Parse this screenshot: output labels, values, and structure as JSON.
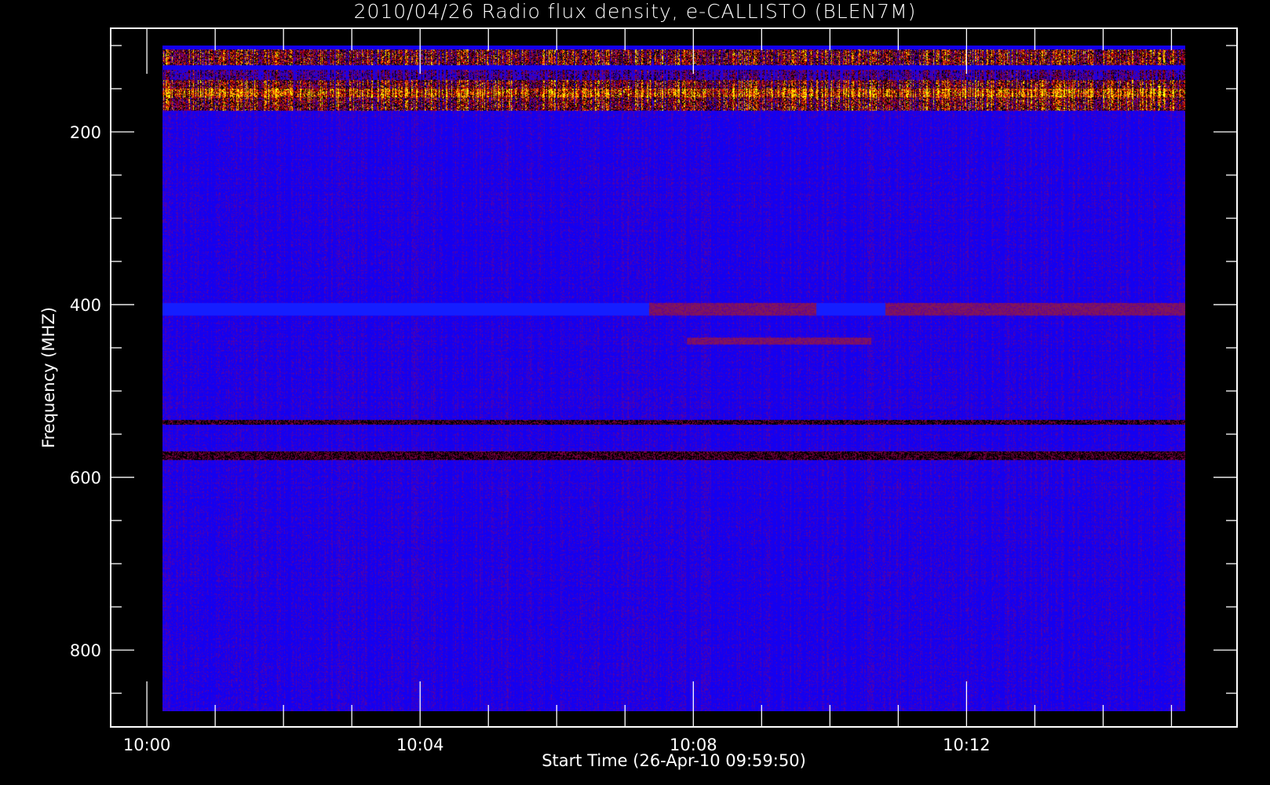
{
  "chart_data": {
    "type": "heatmap",
    "title": "2010/04/26  Radio flux density, e-CALLISTO (BLEN7M)",
    "xlabel": "Start Time (26-Apr-10 09:59:50)",
    "ylabel": "Frequency (MHZ)",
    "x_ticks": [
      {
        "label": "10:00",
        "min": 0
      },
      {
        "label": "10:04",
        "min": 4
      },
      {
        "label": "10:08",
        "min": 8
      },
      {
        "label": "10:12",
        "min": 12
      }
    ],
    "x_minor_step_min": 1,
    "y_ticks": [
      {
        "label": "200",
        "mhz": 200
      },
      {
        "label": "400",
        "mhz": 400
      },
      {
        "label": "600",
        "mhz": 600
      },
      {
        "label": "800",
        "mhz": 800
      }
    ],
    "y_minor_step_mhz": 50,
    "xlim_min_after_1000": [
      -0.53,
      15.96
    ],
    "ylim_mhz": [
      889,
      80
    ],
    "data_extent": {
      "time_start_min": 0.23,
      "time_end_min": 15.2,
      "freq_min_mhz": 100,
      "freq_max_mhz": 871
    },
    "colormap": [
      "#1400f0",
      "#5a00a0",
      "#78003c",
      "#000000",
      "#c80000",
      "#ff7800",
      "#ffff00"
    ],
    "features": [
      {
        "desc": "strong RFI band",
        "freq_mhz": [
          100,
          175
        ],
        "time_min": [
          0.23,
          15.2
        ]
      },
      {
        "desc": "enhanced line",
        "freq_mhz": [
          398,
          412
        ],
        "time_min": [
          7.35,
          9.8
        ],
        "level": "red"
      },
      {
        "desc": "enhanced line",
        "freq_mhz": [
          398,
          412
        ],
        "time_min": [
          10.8,
          15.2
        ],
        "level": "red"
      },
      {
        "desc": "enhanced line",
        "freq_mhz": [
          438,
          446
        ],
        "time_min": [
          7.9,
          10.6
        ],
        "level": "red"
      },
      {
        "desc": "dark line",
        "freq_mhz": [
          533,
          539
        ],
        "time_min": [
          0.23,
          15.2
        ]
      },
      {
        "desc": "dark line",
        "freq_mhz": [
          570,
          580
        ],
        "time_min": [
          0.23,
          15.2
        ]
      }
    ]
  }
}
